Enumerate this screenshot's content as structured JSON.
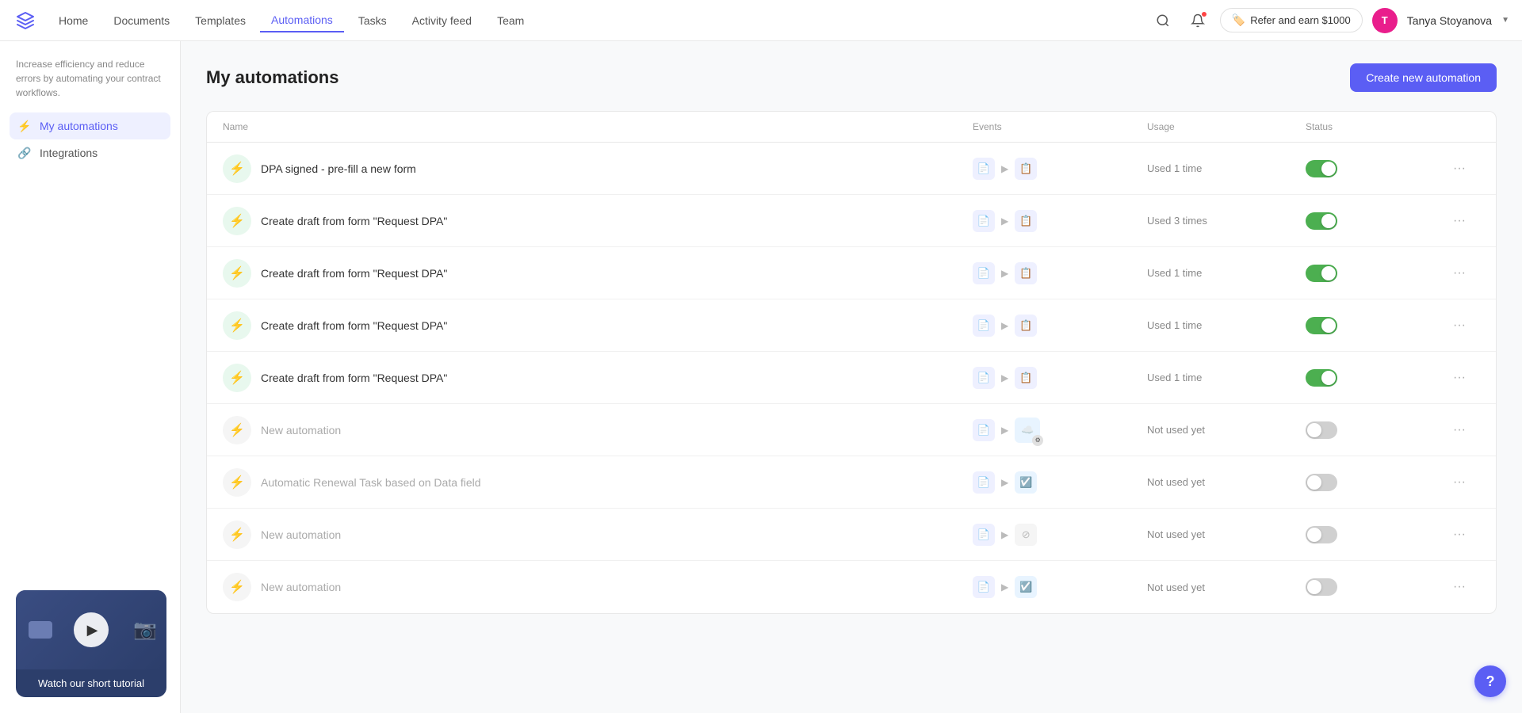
{
  "nav": {
    "items": [
      {
        "label": "Home",
        "active": false
      },
      {
        "label": "Documents",
        "active": false
      },
      {
        "label": "Templates",
        "active": false
      },
      {
        "label": "Automations",
        "active": true
      },
      {
        "label": "Tasks",
        "active": false
      },
      {
        "label": "Activity feed",
        "active": false
      },
      {
        "label": "Team",
        "active": false
      }
    ],
    "refer_label": "Refer and earn $1000",
    "user_name": "Tanya Stoyanova",
    "user_initials": "T"
  },
  "sidebar": {
    "description": "Increase efficiency and reduce errors by automating your contract workflows.",
    "items": [
      {
        "label": "My automations",
        "active": true,
        "icon": "⚡"
      },
      {
        "label": "Integrations",
        "active": false,
        "icon": "🔗"
      }
    ]
  },
  "main": {
    "title": "My automations",
    "create_btn": "Create new automation"
  },
  "table": {
    "headers": [
      "Name",
      "Events",
      "Usage",
      "Status",
      ""
    ],
    "rows": [
      {
        "id": 1,
        "name": "DPA signed - pre-fill a new form",
        "active_icon": true,
        "events_type": "doc_arrow_doc",
        "usage": "Used 1 time",
        "status": true
      },
      {
        "id": 2,
        "name": "Create draft from form \"Request DPA\"",
        "active_icon": true,
        "events_type": "doc_arrow_doc",
        "usage": "Used 3 times",
        "status": true
      },
      {
        "id": 3,
        "name": "Create draft from form \"Request DPA\"",
        "active_icon": true,
        "events_type": "doc_arrow_doc",
        "usage": "Used 1 time",
        "status": true
      },
      {
        "id": 4,
        "name": "Create draft from form \"Request DPA\"",
        "active_icon": true,
        "events_type": "doc_arrow_doc",
        "usage": "Used 1 time",
        "status": true
      },
      {
        "id": 5,
        "name": "Create draft from form \"Request DPA\"",
        "active_icon": true,
        "events_type": "doc_arrow_doc",
        "usage": "Used 1 time",
        "status": true
      },
      {
        "id": 6,
        "name": "New automation",
        "active_icon": false,
        "events_type": "doc_arrow_salesforce",
        "usage": "Not used yet",
        "status": false
      },
      {
        "id": 7,
        "name": "Automatic Renewal Task based on Data field",
        "active_icon": false,
        "events_type": "doc_arrow_task",
        "usage": "Not used yet",
        "status": false
      },
      {
        "id": 8,
        "name": "New automation",
        "active_icon": false,
        "events_type": "doc_arrow_disabled",
        "usage": "Not used yet",
        "status": false
      },
      {
        "id": 9,
        "name": "New automation",
        "active_icon": false,
        "events_type": "doc_arrow_task2",
        "usage": "Not used yet",
        "status": false
      }
    ]
  },
  "tutorial": {
    "text": "Watch our short tutorial"
  },
  "help": {
    "label": "?"
  }
}
